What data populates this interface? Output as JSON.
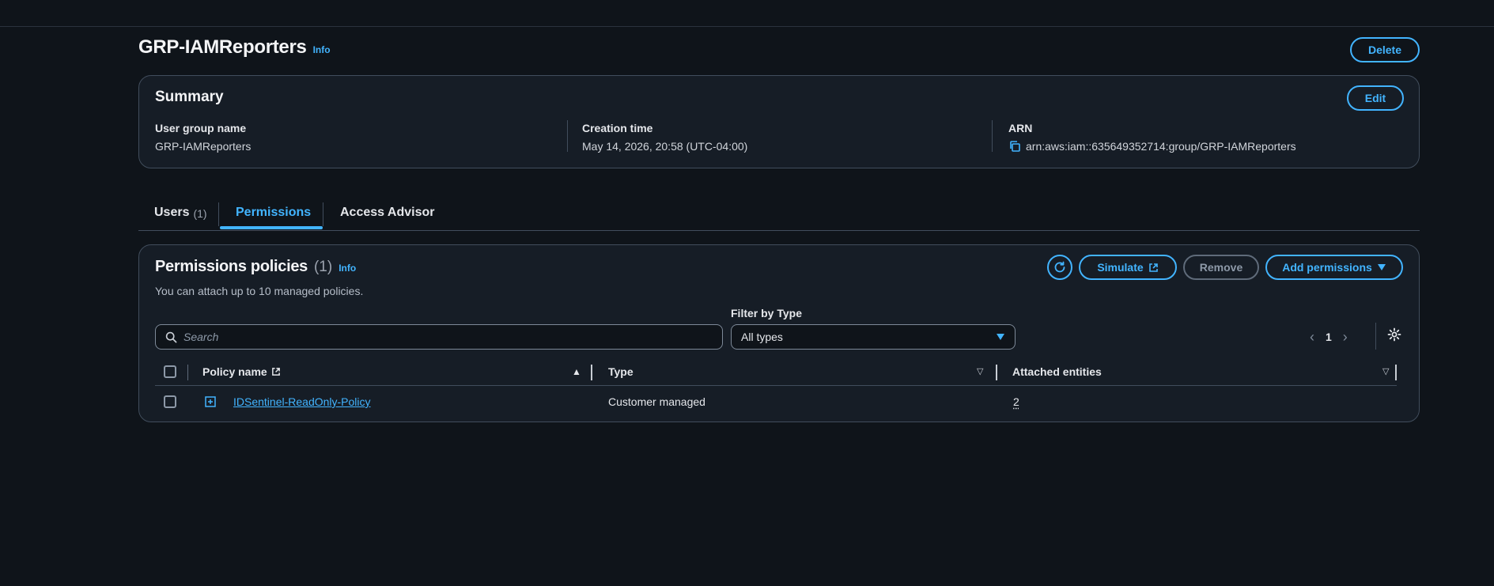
{
  "header": {
    "title": "GRP-IAMReporters",
    "info": "Info",
    "delete_label": "Delete"
  },
  "summary": {
    "title": "Summary",
    "edit_label": "Edit",
    "group_name_label": "User group name",
    "group_name_value": "GRP-IAMReporters",
    "creation_label": "Creation time",
    "creation_value": "May 14, 2026, 20:58 (UTC-04:00)",
    "arn_label": "ARN",
    "arn_value": "arn:aws:iam::635649352714:group/GRP-IAMReporters",
    "arn_icon": "copy-icon"
  },
  "tabs": [
    {
      "label": "Users",
      "count": "(1)",
      "active": false
    },
    {
      "label": "Permissions",
      "active": true
    },
    {
      "label": "Access Advisor",
      "active": false
    }
  ],
  "permissions": {
    "title": "Permissions policies",
    "count": "(1)",
    "info": "Info",
    "subtitle": "You can attach up to 10 managed policies.",
    "simulate_label": "Simulate",
    "remove_label": "Remove",
    "add_label": "Add permissions",
    "search_placeholder": "Search",
    "filter_label": "Filter by Type",
    "filter_value": "All types",
    "page": "1",
    "columns": {
      "name": "Policy name",
      "type": "Type",
      "entities": "Attached entities"
    },
    "rows": [
      {
        "name": "IDSentinel-ReadOnly-Policy",
        "type": "Customer managed",
        "entities": "2"
      }
    ]
  },
  "colors": {
    "accent": "#42b4ff",
    "background": "#0f141a",
    "panel": "#161d26",
    "border": "#414d5c"
  }
}
